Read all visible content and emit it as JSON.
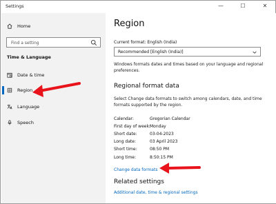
{
  "window": {
    "title": "Settings",
    "controls": {
      "minimize": "—",
      "maximize": "☐",
      "close": "✕"
    }
  },
  "sidebar": {
    "home_label": "Home",
    "search_placeholder": "Find a setting",
    "section_title": "Time & Language",
    "items": [
      {
        "label": "Date & time",
        "icon": "date-time-icon",
        "selected": false
      },
      {
        "label": "Region",
        "icon": "globe-icon",
        "selected": true
      },
      {
        "label": "Language",
        "icon": "language-icon",
        "selected": false
      },
      {
        "label": "Speech",
        "icon": "microphone-icon",
        "selected": false
      }
    ]
  },
  "main": {
    "title": "Region",
    "current_format_label": "Current format: English (India)",
    "format_dropdown_value": "Recommended [English (India)]",
    "format_description": "Windows formats dates and times based on your language and regional preferences.",
    "regional_format_heading": "Regional format data",
    "regional_format_description": "Select Change data formats to switch among calendars, date, and time formats supported by the region.",
    "format_rows": [
      {
        "key": "Calendar:",
        "value": "Gregorian Calendar"
      },
      {
        "key": "First day of week:",
        "value": "Monday"
      },
      {
        "key": "Short date:",
        "value": "03-04-2023"
      },
      {
        "key": "Long date:",
        "value": "03 April 2023"
      },
      {
        "key": "Short time:",
        "value": "08:50 PM"
      },
      {
        "key": "Long time:",
        "value": "8:50:15 PM"
      }
    ],
    "change_formats_link": "Change data formats",
    "related_heading": "Related settings",
    "related_link": "Additional date, time & regional settings"
  },
  "colors": {
    "accent": "#0067c0",
    "annotation_arrow": "#e8131b",
    "sidebar_bg": "#f2f2f2"
  }
}
